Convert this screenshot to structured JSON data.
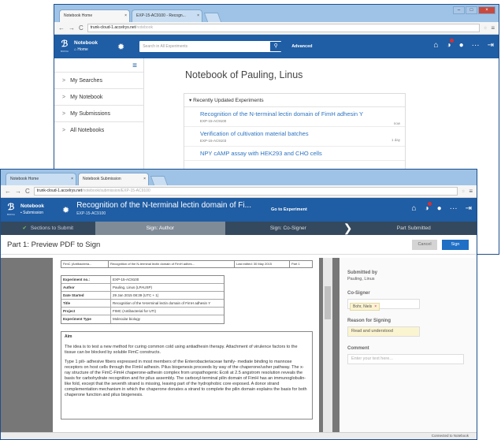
{
  "back_window": {
    "tabs": [
      {
        "label": "Notebook Home"
      },
      {
        "label": "EXP-15-AC9100 - Recogn..."
      }
    ],
    "url": {
      "domain": "trunk-cloud-1.accelrys.net",
      "path": "/notebook"
    },
    "app": {
      "name": "Notebook",
      "section": "Home"
    },
    "search": {
      "placeholder": "Search in All Experiments",
      "advanced": "Advanced"
    },
    "sidebar": {
      "items": [
        {
          "label": "My Searches"
        },
        {
          "label": "My Notebook"
        },
        {
          "label": "My Submissions"
        },
        {
          "label": "All Notebooks"
        }
      ]
    },
    "main": {
      "title": "Notebook of Pauling, Linus",
      "panel_title": "Recently Updated Experiments",
      "experiments": [
        {
          "name": "Recognition of the N-terminal lectin domain of FimH adhesin Y",
          "id": "EXP-15-AC9100",
          "time": "now"
        },
        {
          "name": "Verification of cultivation material batches",
          "id": "EXP-15-AC9103",
          "time": "1 day"
        },
        {
          "name": "NPY cAMP assay with HEK293 and CHO cells",
          "id": "",
          "time": ""
        }
      ]
    }
  },
  "front_window": {
    "tabs": [
      {
        "label": "Notebook Home"
      },
      {
        "label": "Notebook Submission"
      }
    ],
    "url": {
      "domain": "trunk-cloud-1.accelrys.net",
      "path": "/notebook/submission/EXP-15-AC9100"
    },
    "app": {
      "name": "Notebook",
      "section": "Submission"
    },
    "experiment": {
      "title": "Recognition of the N-terminal lectin domain of Fi...",
      "id": "EXP-15-AC9100"
    },
    "goto_label": "Go to Experiment",
    "steps": [
      {
        "label": "Sections to Submit",
        "state": "done"
      },
      {
        "label": "Sign: Author",
        "state": "current"
      },
      {
        "label": "Sign: Co-Signer",
        "state": "pending"
      },
      {
        "label": "Part Submitted",
        "state": "pending"
      }
    ],
    "part_title": "Part 1: Preview PDF to Sign",
    "cancel_label": "Cancel",
    "sign_label": "Sign",
    "pdf": {
      "header_cells": [
        "FimC (Antibacteria...",
        "Recognition of the N-terminal lectin domain of FimH adhes...",
        "Last edited: 30 May 2015",
        "Part 1"
      ],
      "meta": [
        {
          "key": "Experiment no.:",
          "value": "EXP-15-AC9100"
        },
        {
          "key": "Author",
          "value": "Pauling, Linus (LPAUSP)"
        },
        {
          "key": "Date Started",
          "value": "29 Jan 2015 08:39 (UTC + 1)"
        },
        {
          "key": "Title",
          "value": "Recognition of the N-terminal lectin domain of FimH adhesin Y"
        },
        {
          "key": "Project",
          "value": "FIMC (Antibacterial for UTI)"
        },
        {
          "key": "Experiment Type",
          "value": "Molecular biology"
        }
      ],
      "aim_heading": "Aim",
      "aim_p1": "The idea is to test a new method for curing common cold using antiadhesin therapy. Attachment of virulence factors to the tissue can be blocked by soluble FimC constructs.",
      "aim_p2": "Type 1 pili- adhesive fibers expressed in most members of the Enterobacteriaceae family- mediate binding to mannose receptors on host cells through the FimH adhesin. Pilus biogenesis proceeds by way of the chaperone/usher pathway. The x-ray structure of the FimC-FimH chaperone-adhesin complex from uropathogenic Ecoli at 2.5 angstrom resolution reveals the basis for carbohydrate recognition and for pilus assembly. The carboxyl-terminal pilin domain of FimH has an immunoglobulin-like fold, except that the seventh strand is missing, leaving part of the hydrophobic core exposed. A donor strand complementation mechanism in which the chaperone donates a strand to complete the pilin domain explains the basis for both chaperone function and pilus biogenesis."
    },
    "right_panel": {
      "submitted_by_label": "Submitted by",
      "submitted_by": "Pauling, Linus",
      "cosigner_label": "Co-Signer",
      "cosigner": "Bohr, Niels",
      "reason_label": "Reason for Signing",
      "reason": "Read and understood",
      "comment_label": "Comment",
      "comment_placeholder": "Enter your text here..."
    },
    "status": "Connected to Notebook"
  },
  "colors": {
    "appbar": "#1f5da4",
    "steps_bg": "#34495e",
    "current_step": "#7f8b97",
    "sign_button": "#1f6fc5",
    "link": "#2e74c0"
  }
}
